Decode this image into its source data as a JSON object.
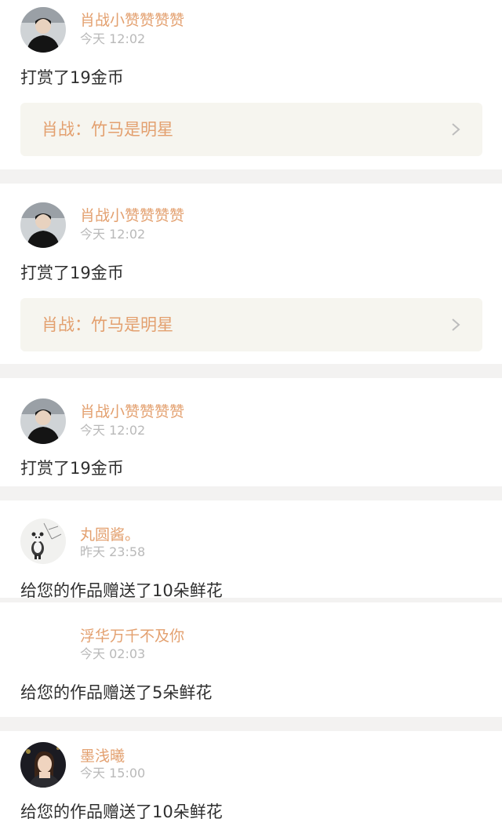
{
  "feed": [
    {
      "avatar_icon": "user-photo-avatar",
      "username": "肖战小赞赞赞赞",
      "time": "今天 12:02",
      "message": "打赏了19金币",
      "work": {
        "title": "肖战：竹马是明星",
        "icon": "chevron-right-icon"
      }
    },
    {
      "avatar_icon": "user-photo-avatar",
      "username": "肖战小赞赞赞赞",
      "time": "今天 12:02",
      "message": "打赏了19金币",
      "work": {
        "title": "肖战：竹马是明星",
        "icon": "chevron-right-icon"
      }
    },
    {
      "avatar_icon": "user-photo-avatar",
      "username": "肖战小赞赞赞赞",
      "time": "今天 12:02",
      "message": "打赏了19金币"
    },
    {
      "avatar_icon": "panda-avatar",
      "username": "丸圆酱。",
      "time": "昨天 23:58",
      "message": "给您的作品赠送了10朵鲜花"
    },
    {
      "avatar_icon": "blank-avatar",
      "username": "浮华万千不及你",
      "time": "今天 02:03",
      "message": "给您的作品赠送了5朵鲜花"
    },
    {
      "avatar_icon": "user-photo-avatar",
      "username": "墨浅曦",
      "time": "今天 15:00",
      "message": "给您的作品赠送了10朵鲜花"
    }
  ],
  "colors": {
    "username": "#e3a06f",
    "timestamp": "#b9b9b9",
    "message": "#2f2f2f",
    "work_link_bg": "#f6f5ef",
    "separator": "#f3f2f1"
  }
}
